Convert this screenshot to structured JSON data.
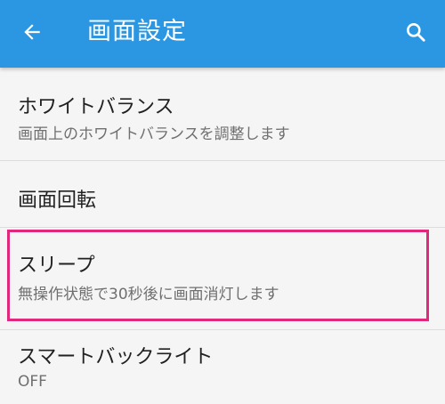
{
  "appbar": {
    "title": "画面設定",
    "back_icon": "arrow-left-icon",
    "search_icon": "search-icon",
    "color": "#2b97e2"
  },
  "settings": {
    "items": [
      {
        "title": "ホワイトバランス",
        "subtitle": "画面上のホワイトバランスを調整します"
      },
      {
        "title": "画面回転"
      },
      {
        "title": "スリープ",
        "subtitle": "無操作状態で30秒後に画面消灯します"
      },
      {
        "title": "スマートバックライト",
        "subtitle": "OFF"
      }
    ]
  },
  "highlight_color": "#e0287c"
}
